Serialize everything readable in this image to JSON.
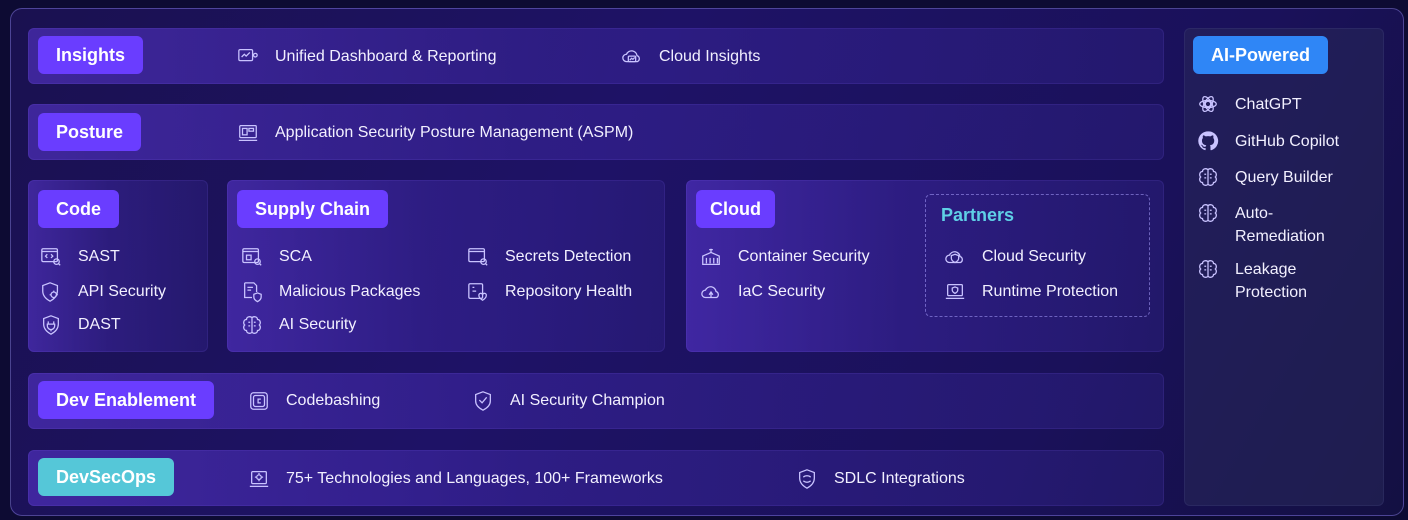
{
  "insights": {
    "label": "Insights",
    "items": [
      {
        "label": "Unified Dashboard & Reporting",
        "icon": "dashboard-icon"
      },
      {
        "label": "Cloud Insights",
        "icon": "cloud-insights-icon"
      }
    ]
  },
  "posture": {
    "label": "Posture",
    "items": [
      {
        "label": "Application Security Posture Management (ASPM)",
        "icon": "monitor-icon"
      }
    ]
  },
  "code": {
    "label": "Code",
    "items": [
      {
        "label": "SAST",
        "icon": "code-window-icon"
      },
      {
        "label": "API Security",
        "icon": "shield-gear-icon"
      },
      {
        "label": "DAST",
        "icon": "shield-plug-icon"
      }
    ]
  },
  "supply_chain": {
    "label": "Supply Chain",
    "items": [
      {
        "label": "SCA",
        "icon": "package-window-icon"
      },
      {
        "label": "Malicious Packages",
        "icon": "document-shield-icon"
      },
      {
        "label": "AI Security",
        "icon": "brain-icon"
      },
      {
        "label": "Secrets Detection",
        "icon": "password-window-icon"
      },
      {
        "label": "Repository Health",
        "icon": "repo-heart-icon"
      }
    ]
  },
  "cloud": {
    "label": "Cloud",
    "items": [
      {
        "label": "Container Security",
        "icon": "container-icon"
      },
      {
        "label": "IaC Security",
        "icon": "cloud-code-icon"
      }
    ]
  },
  "partners": {
    "label": "Partners",
    "items": [
      {
        "label": "Cloud Security",
        "icon": "cloud-shield-icon"
      },
      {
        "label": "Runtime Protection",
        "icon": "laptop-shield-icon"
      }
    ]
  },
  "dev_enablement": {
    "label": "Dev Enablement",
    "items": [
      {
        "label": "Codebashing",
        "icon": "codebashing-icon"
      },
      {
        "label": "AI Security Champion",
        "icon": "badge-icon"
      }
    ]
  },
  "devsecops": {
    "label": "DevSecOps",
    "items": [
      {
        "label": "75+ Technologies and Languages, 100+ Frameworks",
        "icon": "tech-gear-icon"
      },
      {
        "label": "SDLC Integrations",
        "icon": "sdlc-shield-icon"
      }
    ]
  },
  "ai_powered": {
    "label": "AI-Powered",
    "items": [
      {
        "label": "ChatGPT",
        "icon": "chatgpt-icon"
      },
      {
        "label": "GitHub Copilot",
        "icon": "github-icon"
      },
      {
        "label": "Query Builder",
        "icon": "brain-icon"
      },
      {
        "label": "Auto-Remediation",
        "icon": "brain-icon"
      },
      {
        "label": "Leakage Protection",
        "icon": "brain-icon"
      }
    ]
  },
  "colors": {
    "pill_purple": "#6a3dff",
    "pill_teal": "#55c7d8",
    "pill_blue": "#2f86f6",
    "partners_title": "#5fd0e6",
    "background": "#0d0b33"
  }
}
